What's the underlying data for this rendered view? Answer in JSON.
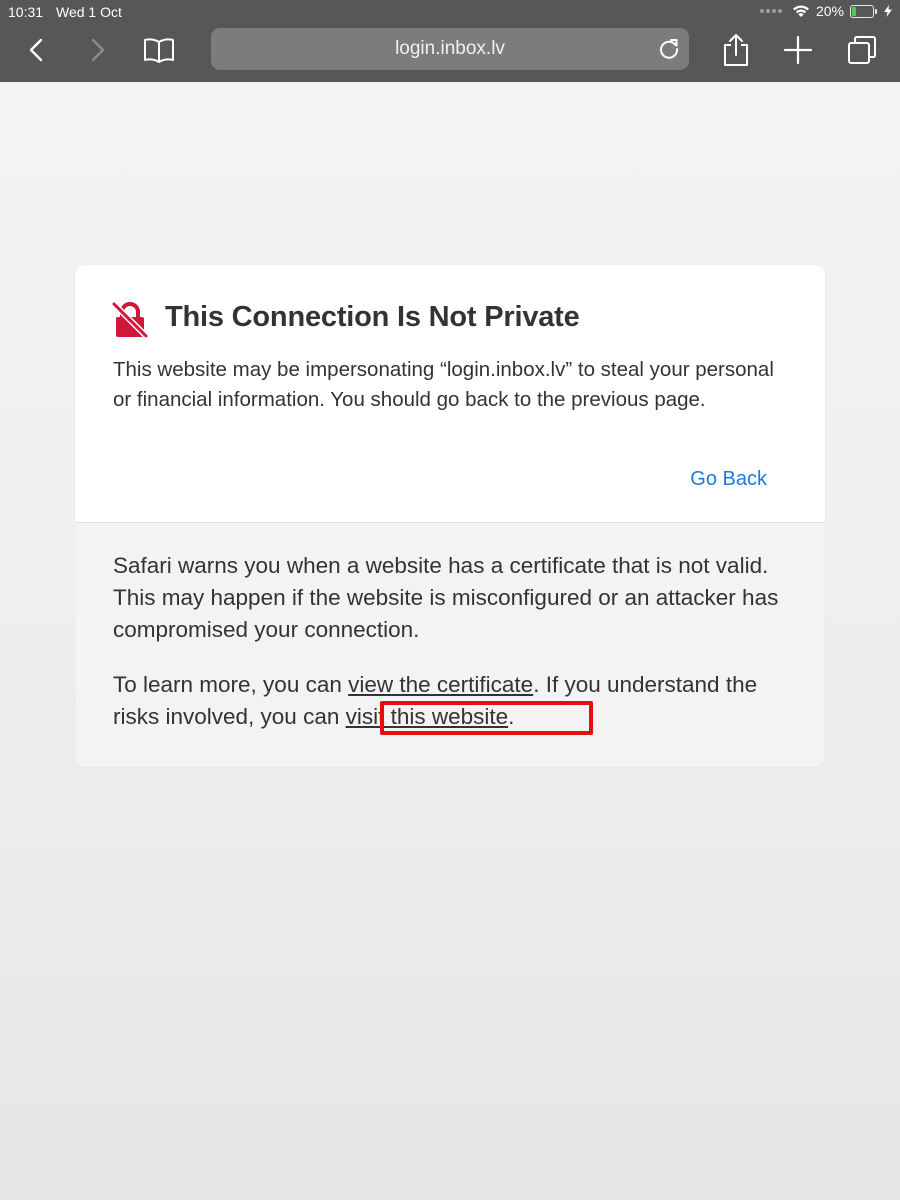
{
  "status_bar": {
    "time": "10:31",
    "date": "Wed 1 Oct",
    "battery_percent": "20%",
    "battery_level": 0.2,
    "battery_color": "#56c45c"
  },
  "toolbar": {
    "url": "login.inbox.lv",
    "icons": [
      "back-icon",
      "forward-icon",
      "bookmarks-icon",
      "reload-icon",
      "share-icon",
      "new-tab-icon",
      "tabs-icon"
    ]
  },
  "warning": {
    "title": "This Connection Is Not Private",
    "body": "This website may be impersonating “login.inbox.lv” to steal your personal or financial information. You should go back to the previous page.",
    "go_back": "Go Back",
    "detail_1": "Safari warns you when a website has a certificate that is not valid. This may happen if the website is misconfigured or an attacker has compromised your connection.",
    "detail_2_prefix": "To learn more, you can ",
    "view_certificate_link": "view the certificate",
    "detail_2_middle": ". If you understand the risks involved, you can ",
    "visit_website_link": "visit this website",
    "detail_2_suffix": ".",
    "accent_color": "#1b7ae0",
    "icon_color": "#d0173a",
    "highlight_color": "#e30f0f"
  }
}
